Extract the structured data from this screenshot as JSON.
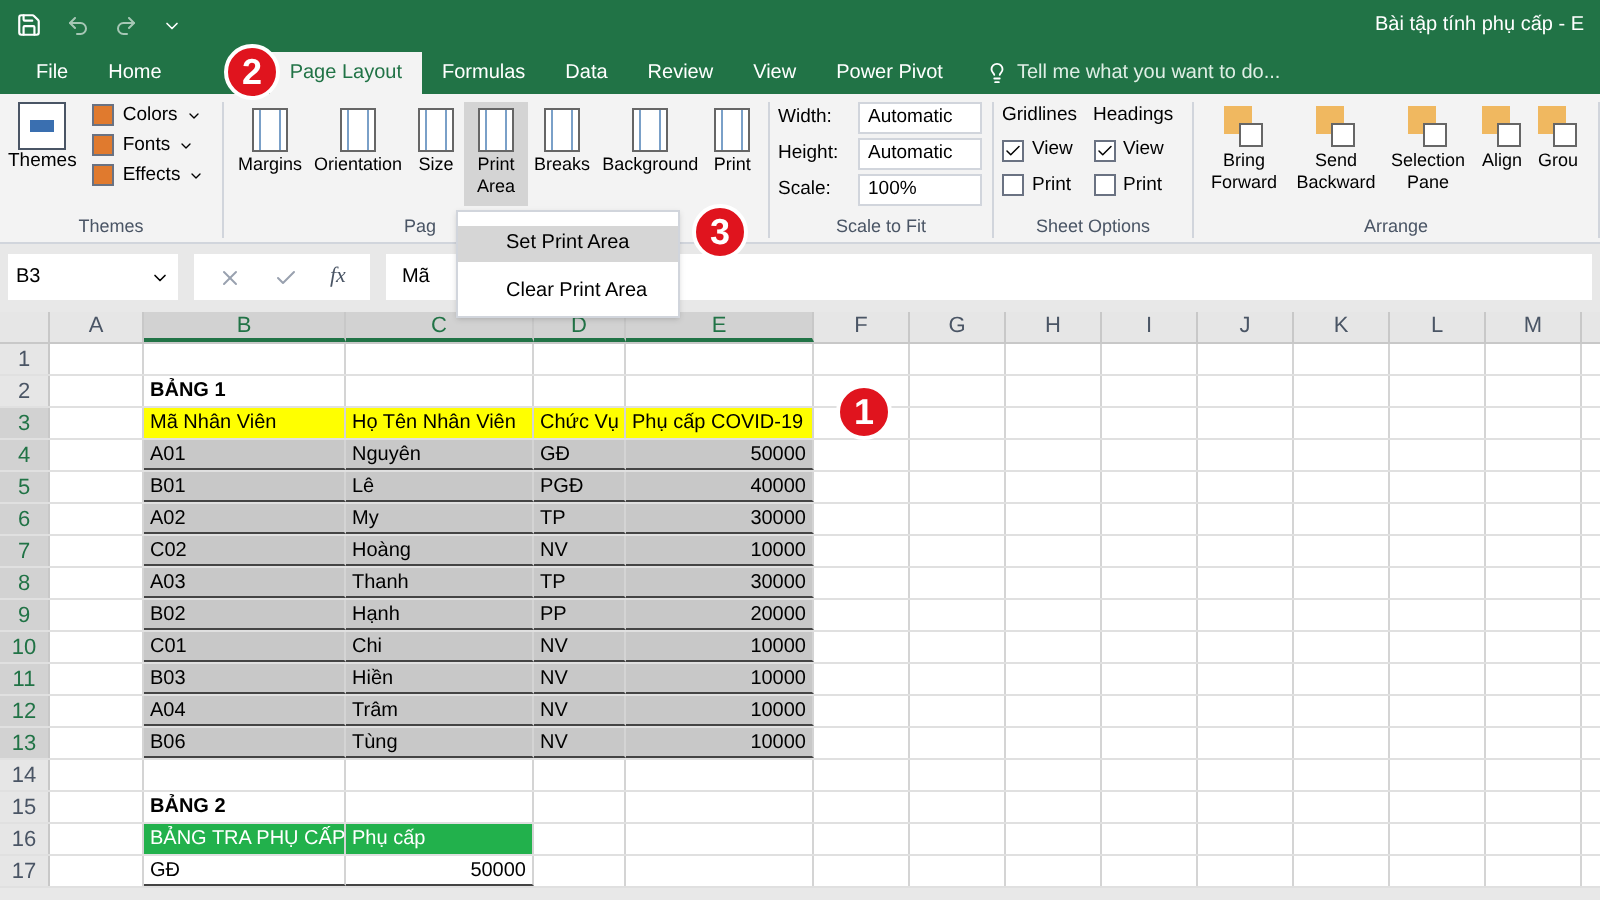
{
  "window": {
    "title": "Bài tập tính phụ cấp - E"
  },
  "tabs": [
    {
      "label": "File",
      "selected": false
    },
    {
      "label": "Home",
      "selected": false
    },
    {
      "label": "Page Layout",
      "selected": true
    },
    {
      "label": "Formulas",
      "selected": false
    },
    {
      "label": "Data",
      "selected": false
    },
    {
      "label": "Review",
      "selected": false
    },
    {
      "label": "View",
      "selected": false
    },
    {
      "label": "Power Pivot",
      "selected": false
    }
  ],
  "tell_me": {
    "placeholder": "Tell me what you want to do..."
  },
  "ribbon": {
    "groups": [
      {
        "kind": "themes",
        "label": "Themes",
        "big": "Themes",
        "small": [
          "Colors",
          "Fonts",
          "Effects"
        ]
      },
      {
        "kind": "page_setup",
        "label": "Pag",
        "buttons": [
          {
            "label": "Margins",
            "selected": false
          },
          {
            "label": "Orientation",
            "selected": false
          },
          {
            "label": "Size",
            "selected": false
          },
          {
            "label": "Print Area",
            "selected": true
          },
          {
            "label": "Breaks",
            "selected": false
          },
          {
            "label": "Background",
            "selected": false
          },
          {
            "label": "Print",
            "selected": false
          }
        ]
      },
      {
        "kind": "scale",
        "label": "Scale to Fit",
        "rows": [
          {
            "label": "Width:",
            "value": "Automatic"
          },
          {
            "label": "Height:",
            "value": "Automatic"
          },
          {
            "label": "Scale:",
            "value": "100%"
          }
        ]
      },
      {
        "kind": "sheet_options",
        "label": "Sheet Options",
        "columns": [
          {
            "title": "Gridlines",
            "options": [
              {
                "label": "View",
                "checked": true
              },
              {
                "label": "Print",
                "checked": false
              }
            ]
          },
          {
            "title": "Headings",
            "options": [
              {
                "label": "View",
                "checked": true
              },
              {
                "label": "Print",
                "checked": false
              }
            ]
          }
        ]
      },
      {
        "kind": "arrange",
        "label": "Arrange",
        "buttons": [
          "Bring Forward",
          "Send Backward",
          "Selection Pane",
          "Align",
          "Grou"
        ]
      }
    ]
  },
  "menu": {
    "items": [
      {
        "label": "Set Print Area",
        "selected": true
      },
      {
        "label": "Clear Print Area",
        "selected": false
      }
    ]
  },
  "formula_bar": {
    "name_box": "B3",
    "function_label": "fx",
    "value": "Mã"
  },
  "sheet": {
    "columns": [
      {
        "label": "A",
        "selected": false
      },
      {
        "label": "B",
        "selected": true
      },
      {
        "label": "C",
        "selected": true
      },
      {
        "label": "D",
        "selected": true
      },
      {
        "label": "E",
        "selected": true
      },
      {
        "label": "F",
        "selected": false
      },
      {
        "label": "G",
        "selected": false
      },
      {
        "label": "H",
        "selected": false
      },
      {
        "label": "I",
        "selected": false
      },
      {
        "label": "J",
        "selected": false
      },
      {
        "label": "K",
        "selected": false
      },
      {
        "label": "L",
        "selected": false
      },
      {
        "label": "M",
        "selected": false
      }
    ],
    "row_numbers": [
      "1",
      "2",
      "3",
      "4",
      "5",
      "6",
      "7",
      "8",
      "9",
      "10",
      "11",
      "12",
      "13",
      "14",
      "15",
      "16",
      "17"
    ]
  },
  "table_1": {
    "title": "BẢNG 1",
    "columns": [
      "Mã Nhân Viên",
      "Họ Tên Nhân Viên",
      "Chức Vụ",
      "Phụ cấp COVID-19"
    ],
    "rows": [
      {
        "cells": [
          "A01",
          "Nguyên",
          "GĐ",
          "50000"
        ],
        "selected": true
      },
      {
        "cells": [
          "B01",
          "Lê",
          "PGĐ",
          "40000"
        ],
        "selected": true
      },
      {
        "cells": [
          "A02",
          "My",
          "TP",
          "30000"
        ],
        "selected": true
      },
      {
        "cells": [
          "C02",
          "Hoàng",
          "NV",
          "10000"
        ],
        "selected": true
      },
      {
        "cells": [
          "A03",
          "Thanh",
          "TP",
          "30000"
        ],
        "selected": true
      },
      {
        "cells": [
          "B02",
          "Hạnh",
          "PP",
          "20000"
        ],
        "selected": true
      },
      {
        "cells": [
          "C01",
          "Chi",
          "NV",
          "10000"
        ],
        "selected": true
      },
      {
        "cells": [
          "B03",
          "Hiền",
          "NV",
          "10000"
        ],
        "selected": true
      },
      {
        "cells": [
          "A04",
          "Trâm",
          "NV",
          "10000"
        ],
        "selected": true
      },
      {
        "cells": [
          "B06",
          "Tùng",
          "NV",
          "10000"
        ],
        "selected": true
      }
    ]
  },
  "table_2": {
    "title": "BẢNG 2",
    "columns": [
      "BẢNG TRA PHỤ CẤP",
      "Phụ cấp"
    ],
    "rows": [
      {
        "cells": [
          "GĐ",
          "50000"
        ],
        "selected": false
      }
    ]
  },
  "callouts": [
    "1",
    "2",
    "3"
  ]
}
